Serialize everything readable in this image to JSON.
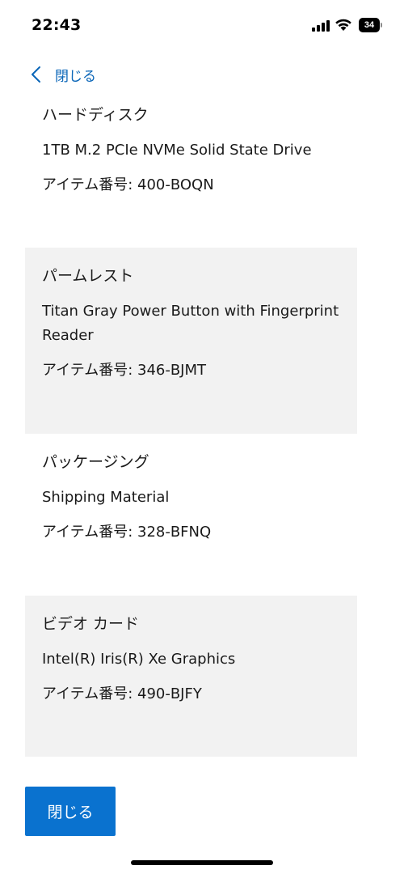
{
  "status_bar": {
    "time": "22:43",
    "battery_level": "34",
    "icons": [
      "signal-icon",
      "wifi-icon",
      "battery-icon"
    ]
  },
  "nav": {
    "back_label": "閉じる",
    "back_icon": "chevron-left-icon",
    "accent_color": "#0a66b8"
  },
  "items": [
    {
      "category": "ハードディスク",
      "description": "1TB M.2 PCIe NVMe Solid State Drive",
      "item_number": "アイテム番号: 400-BOQN"
    },
    {
      "category": "パームレスト",
      "description": "Titan Gray Power Button with Fingerprint Reader",
      "item_number": "アイテム番号: 346-BJMT"
    },
    {
      "category": "パッケージング",
      "description": "Shipping Material",
      "item_number": "アイテム番号: 328-BFNQ"
    },
    {
      "category": "ビデオ カード",
      "description": "Intel(R) Iris(R) Xe Graphics",
      "item_number": "アイテム番号: 490-BJFY"
    }
  ],
  "footer": {
    "close_label": "閉じる",
    "button_color": "#0a72cf"
  }
}
